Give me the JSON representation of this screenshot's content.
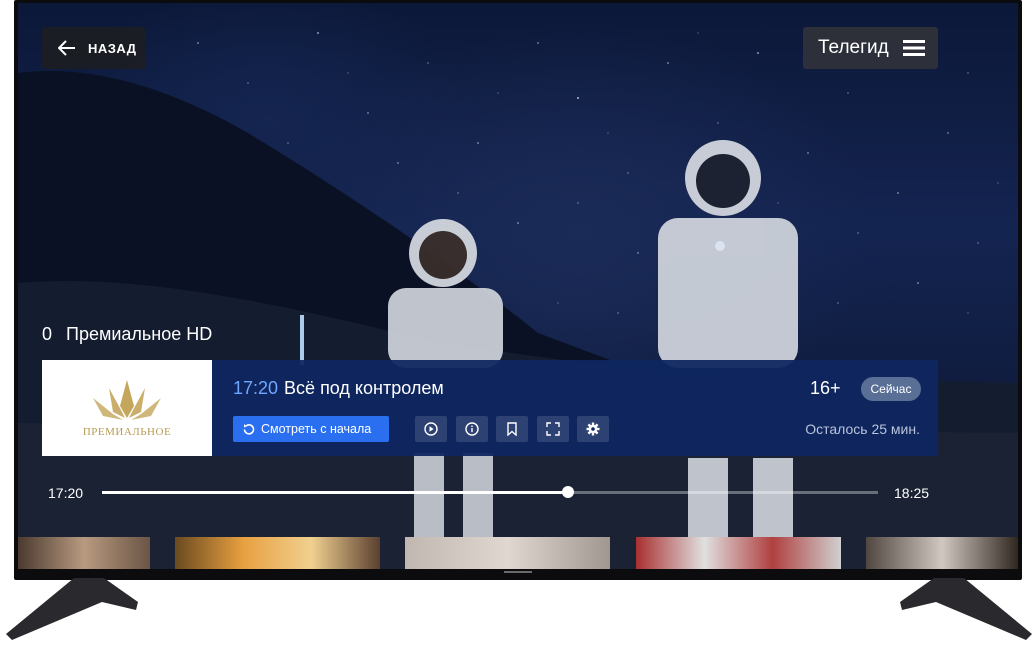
{
  "header": {
    "back_label": "НАЗАД",
    "guide_label": "Телегид"
  },
  "channel": {
    "number": "0",
    "name": "Премиальное HD",
    "logo_text": "ПРЕМИАЛЬНОЕ"
  },
  "program": {
    "time": "17:20",
    "title": "Всё под контролем",
    "age_rating": "16+",
    "status_badge": "Сейчас",
    "watch_from_start_label": "Смотреть с начала",
    "remaining": "Осталось 25 мин."
  },
  "progress": {
    "start_time": "17:20",
    "end_time": "18:25",
    "fraction": 0.6
  },
  "icons": [
    "back-arrow-icon",
    "menu-icon",
    "restart-icon",
    "play-icon",
    "info-icon",
    "bookmark-icon",
    "fullscreen-icon",
    "settings-icon"
  ],
  "colors": {
    "accent": "#2b6ff1",
    "time_highlight": "#6fa7ff",
    "panel": "#0e2660",
    "logo_gold": "#b89a52"
  }
}
